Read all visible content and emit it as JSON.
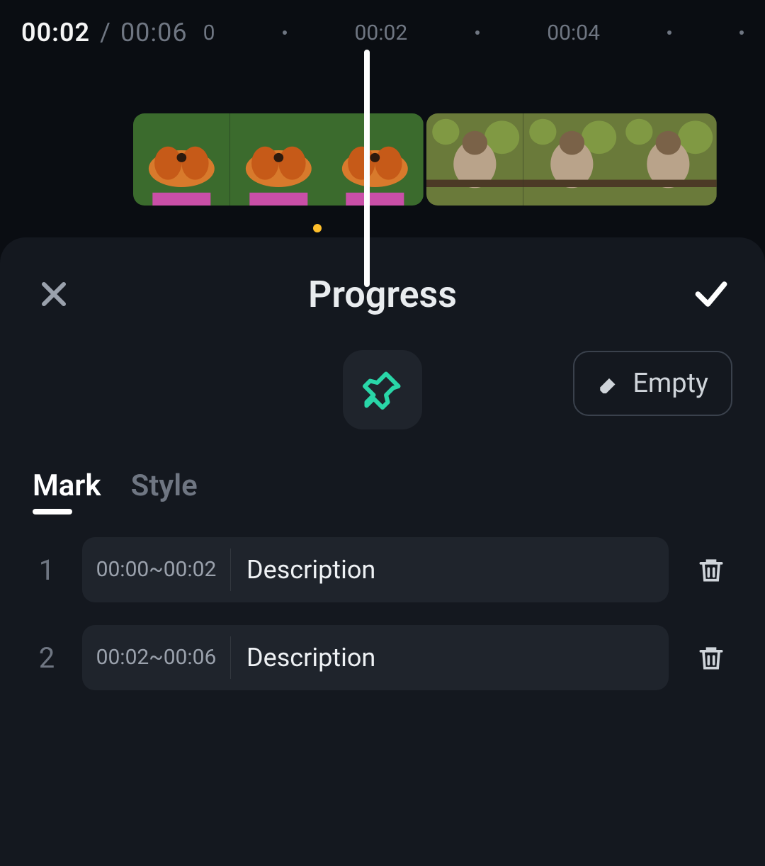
{
  "time": {
    "current": "00:02",
    "total": "00:06"
  },
  "ruler": {
    "labels": [
      "0",
      "00:02",
      "00:04"
    ]
  },
  "panel": {
    "title": "Progress",
    "pin_icon": "pin-icon",
    "empty_label": "Empty"
  },
  "tabs": {
    "mark": "Mark",
    "style": "Style",
    "active": "mark"
  },
  "marks": [
    {
      "index": "1",
      "range": "00:00~00:02",
      "desc": "Description"
    },
    {
      "index": "2",
      "range": "00:02~00:06",
      "desc": "Description"
    }
  ]
}
